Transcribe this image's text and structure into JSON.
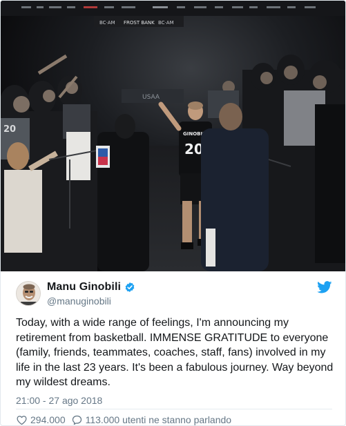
{
  "tweet": {
    "author_name": "Manu Ginobili",
    "author_handle": "@manuginobili",
    "text": "Today, with a wide range of feelings, I'm announcing my retirement from basketball. IMMENSE GRATITUDE to everyone (family, friends, teammates, coaches, staff, fans) involved in my life in the last 23 years. It's been a fabulous journey. Way beyond my wildest dreams.",
    "timestamp": "21:00 - 27 ago 2018",
    "likes_count": "294.000",
    "talking_text": "113.000 utenti ne stanno parlando"
  },
  "photo": {
    "jersey_name": "GINOBILI",
    "jersey_number": "20",
    "fan_jersey_number": "20",
    "banner_text": "USAA",
    "scoreboard_left": "BC·AM",
    "scoreboard_center": "FROST BANK",
    "scoreboard_right": "BC·AM"
  },
  "colors": {
    "verified_blue": "#1da1f2",
    "twitter_blue": "#1da1f2",
    "text_primary": "#14171a",
    "text_secondary": "#657786"
  },
  "icons": [
    "verified-badge-icon",
    "twitter-bird-icon",
    "heart-icon",
    "speech-bubble-icon"
  ]
}
